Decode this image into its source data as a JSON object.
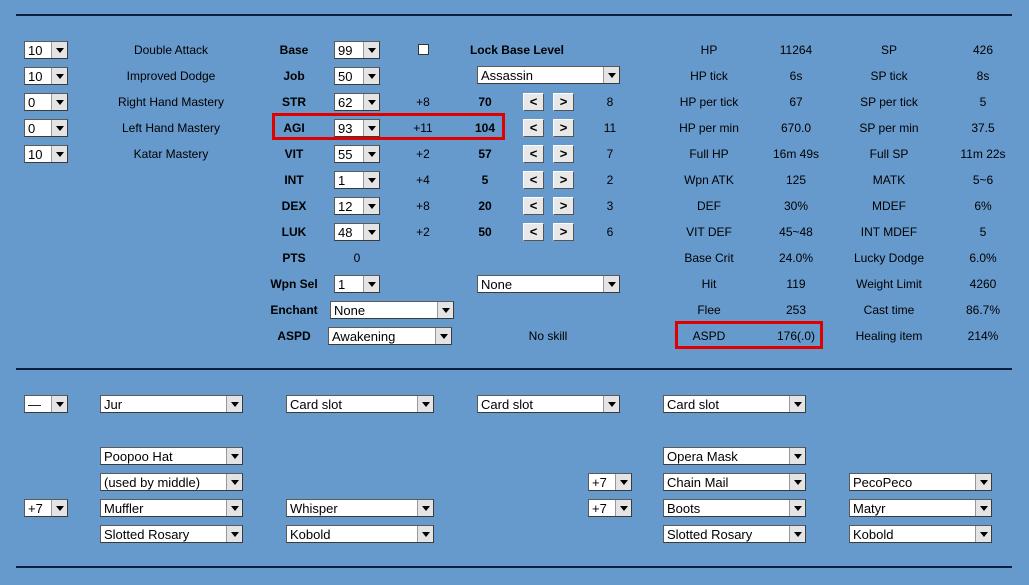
{
  "skills": [
    {
      "level": "10",
      "name": "Double Attack"
    },
    {
      "level": "10",
      "name": "Improved Dodge"
    },
    {
      "level": "0",
      "name": "Right Hand Mastery"
    },
    {
      "level": "0",
      "name": "Left Hand Mastery"
    },
    {
      "level": "10",
      "name": "Katar Mastery"
    }
  ],
  "base": {
    "label": "Base",
    "value": "99"
  },
  "job": {
    "label": "Job",
    "value": "50",
    "class": "Assassin"
  },
  "lock_base_level": "Lock Base Level",
  "stats": [
    {
      "name": "STR",
      "value": "62",
      "bonus": "+8",
      "total": "70",
      "cost": "8"
    },
    {
      "name": "AGI",
      "value": "93",
      "bonus": "+11",
      "total": "104",
      "cost": "11"
    },
    {
      "name": "VIT",
      "value": "55",
      "bonus": "+2",
      "total": "57",
      "cost": "7"
    },
    {
      "name": "INT",
      "value": "1",
      "bonus": "+4",
      "total": "5",
      "cost": "2"
    },
    {
      "name": "DEX",
      "value": "12",
      "bonus": "+8",
      "total": "20",
      "cost": "3"
    },
    {
      "name": "LUK",
      "value": "48",
      "bonus": "+2",
      "total": "50",
      "cost": "6"
    }
  ],
  "buttons": {
    "minus": "<",
    "plus": ">"
  },
  "pts": {
    "label": "PTS",
    "value": "0"
  },
  "wpn_sel": {
    "label": "Wpn Sel",
    "value": "1",
    "skill": "None"
  },
  "enchant": {
    "label": "Enchant",
    "value": "None"
  },
  "aspd_sel": {
    "label": "ASPD",
    "value": "Awakening",
    "skill_text": "No skill"
  },
  "derived": [
    {
      "l1": "HP",
      "v1": "11264",
      "l2": "SP",
      "v2": "426"
    },
    {
      "l1": "HP tick",
      "v1": "6s",
      "l2": "SP tick",
      "v2": "8s"
    },
    {
      "l1": "HP per tick",
      "v1": "67",
      "l2": "SP per tick",
      "v2": "5"
    },
    {
      "l1": "HP per min",
      "v1": "670.0",
      "l2": "SP per min",
      "v2": "37.5"
    },
    {
      "l1": "Full HP",
      "v1": "16m 49s",
      "l2": "Full SP",
      "v2": "11m 22s"
    },
    {
      "l1": "Wpn ATK",
      "v1": "125",
      "l2": "MATK",
      "v2": "5~6"
    },
    {
      "l1": "DEF",
      "v1": "30%",
      "l2": "MDEF",
      "v2": "6%"
    },
    {
      "l1": "VIT DEF",
      "v1": "45~48",
      "l2": "INT MDEF",
      "v2": "5"
    },
    {
      "l1": "Base Crit",
      "v1": "24.0%",
      "l2": "Lucky Dodge",
      "v2": "6.0%"
    },
    {
      "l1": "Hit",
      "v1": "119",
      "l2": "Weight Limit",
      "v2": "4260"
    },
    {
      "l1": "Flee",
      "v1": "253",
      "l2": "Cast time",
      "v2": "86.7%"
    },
    {
      "l1": "ASPD",
      "v1": "176(.0)",
      "l2": "Healing item",
      "v2": "214%"
    }
  ],
  "equip": {
    "weapon_refine": "—",
    "weapon": "Jur",
    "weapon_card1": "Card slot",
    "weapon_card2": "Card slot",
    "weapon_card3": "Card slot",
    "head_top": "Poopoo Hat",
    "head_mid": "(used by middle)",
    "head_low_refine": "+7",
    "head_low": "Muffler",
    "head_low_card": "Whisper",
    "accessory1": "Slotted Rosary",
    "accessory1_card": "Kobold",
    "right_top": "Opera Mask",
    "armor_refine": "+7",
    "armor": "Chain Mail",
    "armor_card": "PecoPeco",
    "shoes_refine": "+7",
    "shoes": "Boots",
    "shoes_card": "Matyr",
    "accessory2": "Slotted Rosary",
    "accessory2_card": "Kobold"
  },
  "colors": {
    "background": "#6699cc",
    "highlight": "#e00000"
  }
}
